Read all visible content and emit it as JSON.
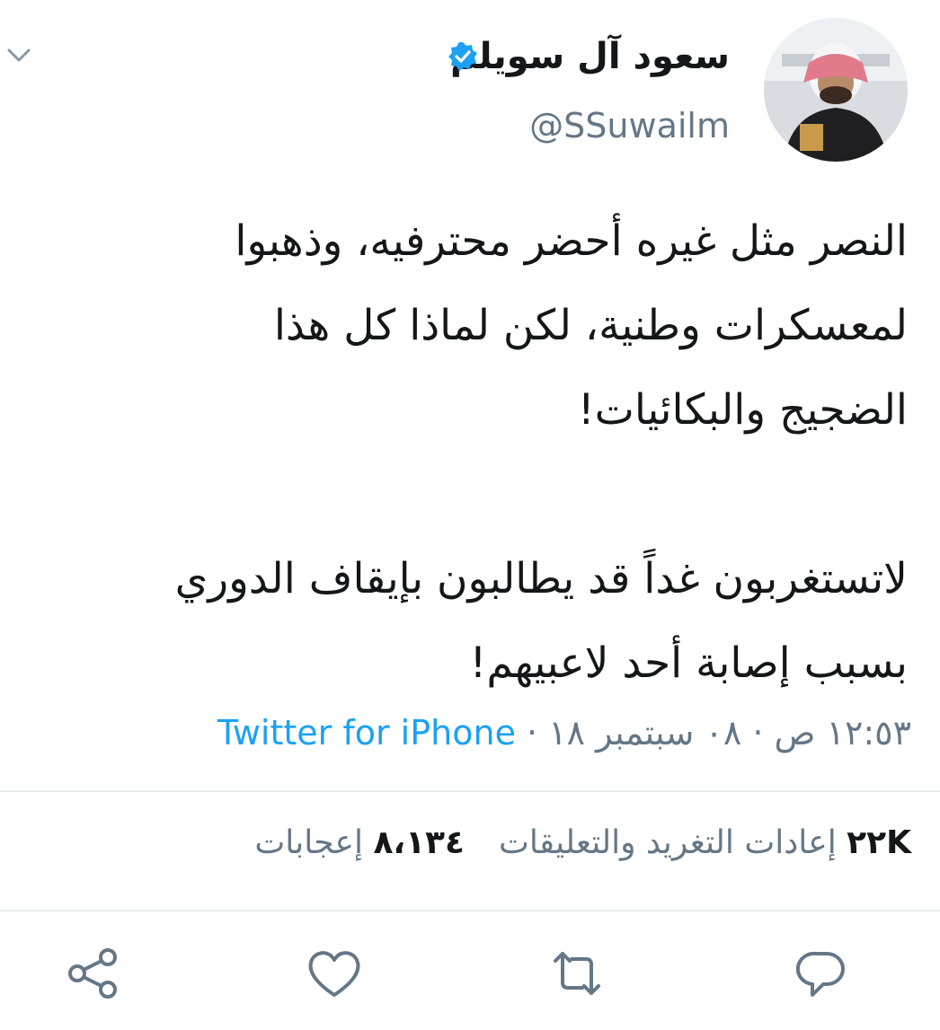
{
  "tweet": {
    "display_name": "سعود آل سويلم",
    "handle": "@SSuwailm",
    "text": "النصر مثل غيره أحضر محترفيه، وذهبوا\nلمعسكرات وطنية، لكن لماذا كل هذا\nالضجيج والبكائيات!\n\nلاتستغربون غداً قد يطالبون بإيقاف الدوري\nبسبب إصابة أحد لاعبيهم!",
    "time": "١٢:٥٣ ص",
    "date": "٠٨ سبتمبر ١٨",
    "separator": "·",
    "source": "Twitter for iPhone"
  },
  "stats": {
    "retweets_count": "٢٢K",
    "retweets_label": "إعادات التغريد والتعليقات",
    "likes_count": "٨،١٣٤",
    "likes_label": "إعجابات"
  },
  "icons": {
    "menu": "chevron-down-icon",
    "verified": "verified-badge-icon",
    "reply": "reply-icon",
    "retweet": "retweet-icon",
    "like": "heart-icon",
    "share": "share-icon"
  },
  "colors": {
    "accent": "#1da1f2",
    "text": "#14171a",
    "muted": "#657786",
    "divider": "#e6ecf0"
  }
}
